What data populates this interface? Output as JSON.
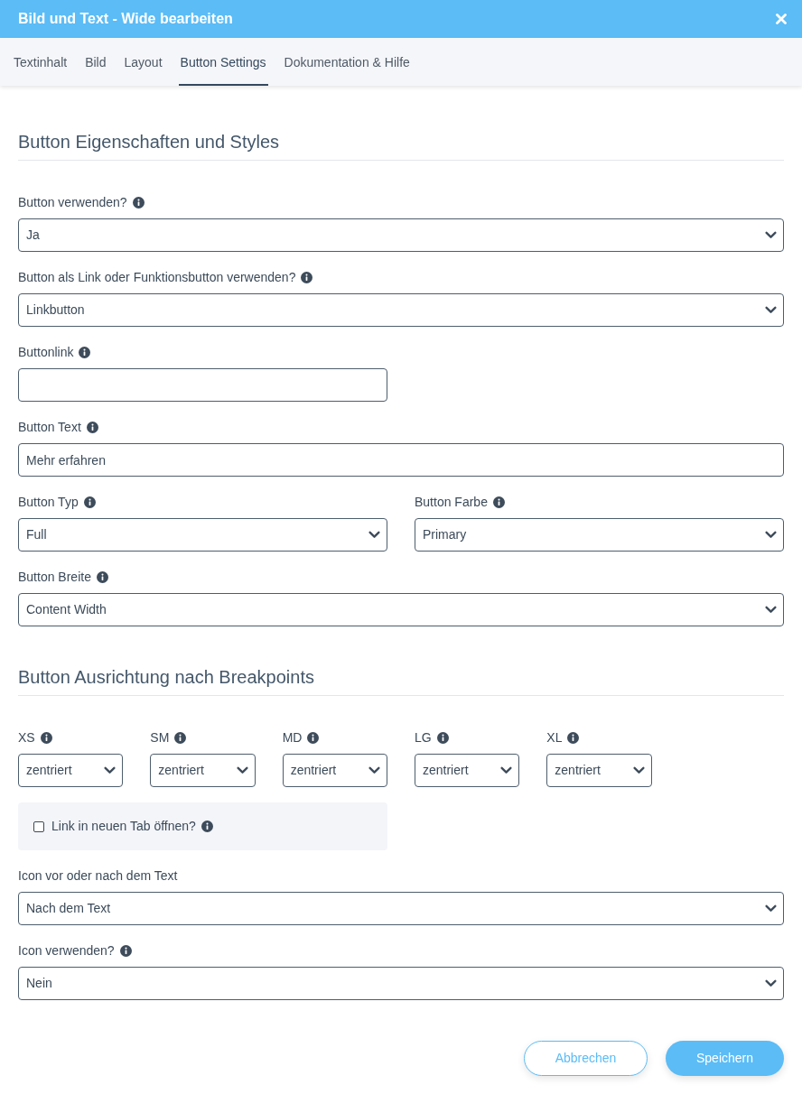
{
  "window": {
    "title": "Bild und Text - Wide bearbeiten"
  },
  "tabs": [
    {
      "label": "Textinhalt",
      "selected": false
    },
    {
      "label": "Bild",
      "selected": false
    },
    {
      "label": "Layout",
      "selected": false
    },
    {
      "label": "Button Settings",
      "selected": true
    },
    {
      "label": "Dokumentation & Hilfe",
      "selected": false
    }
  ],
  "sections": [
    {
      "heading": "Button Eigenschaften und Styles",
      "rows": [
        {
          "kind": "full",
          "fields": [
            {
              "kind": "select",
              "label": "Button verwenden?",
              "info": true,
              "value": "Ja"
            }
          ]
        },
        {
          "kind": "full",
          "fields": [
            {
              "kind": "select",
              "label": "Button als Link oder Funktionsbutton verwenden?",
              "info": true,
              "value": "Linkbutton"
            }
          ]
        },
        {
          "kind": "pair",
          "fields": [
            {
              "kind": "text",
              "label": "Buttonlink",
              "info": true
            }
          ]
        },
        {
          "kind": "full",
          "fields": [
            {
              "kind": "text",
              "label": "Button Text",
              "info": true,
              "value": "Mehr erfahren"
            }
          ]
        },
        {
          "kind": "pair",
          "fields": [
            {
              "kind": "select",
              "label": "Button Typ",
              "info": true,
              "value": "Full"
            },
            {
              "kind": "select",
              "label": "Button Farbe",
              "info": true,
              "value": "Primary"
            }
          ]
        },
        {
          "kind": "full",
          "fields": [
            {
              "kind": "select",
              "label": "Button Breite",
              "info": true,
              "value": "Content Width"
            }
          ]
        }
      ]
    },
    {
      "heading": "Button Ausrichtung nach Breakpoints",
      "rows": [
        {
          "kind": "breakpoints",
          "fields": [
            {
              "kind": "select",
              "label": "XS",
              "info": true,
              "value": "zentriert"
            },
            {
              "kind": "select",
              "label": "SM",
              "info": true,
              "value": "zentriert"
            },
            {
              "kind": "select",
              "label": "MD",
              "info": true,
              "value": "zentriert"
            },
            {
              "kind": "select",
              "label": "LG",
              "info": true,
              "value": "zentriert"
            },
            {
              "kind": "select",
              "label": "XL",
              "info": true,
              "value": "zentriert"
            }
          ]
        },
        {
          "kind": "pair",
          "fields": [
            {
              "kind": "checkbox",
              "label": "Link in neuen Tab öffnen?",
              "info": true,
              "checked": false
            }
          ]
        },
        {
          "kind": "full",
          "fields": [
            {
              "kind": "select",
              "label": "Icon vor oder nach dem Text",
              "info": false,
              "value": "Nach dem Text"
            }
          ]
        },
        {
          "kind": "full",
          "fields": [
            {
              "kind": "select",
              "label": "Icon verwenden?",
              "info": true,
              "value": "Nein"
            }
          ]
        }
      ]
    }
  ],
  "buttons": [
    {
      "kind": "secondary",
      "label": "Abbrechen"
    },
    {
      "kind": "primary",
      "label": "Speichern"
    }
  ]
}
